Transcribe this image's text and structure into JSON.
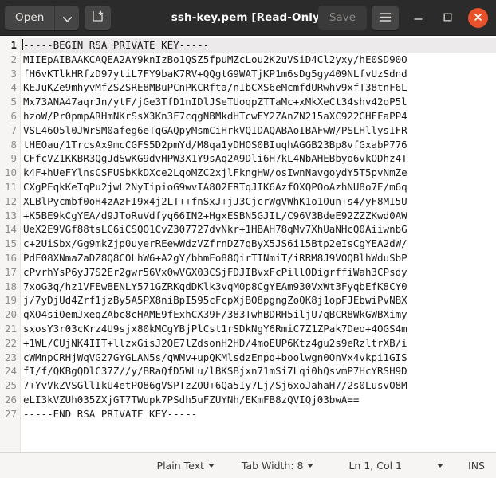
{
  "window": {
    "title": "ssh-key.pem [Read-Only]",
    "accent_close": "#e8512a",
    "headerbar_bg": "#2b2b2b",
    "button_bg": "#454545"
  },
  "headerbar": {
    "open_label": "Open",
    "open_dropdown_icon": "chevron-down-icon",
    "new_tab_icon": "new-tab-icon",
    "save_label": "Save",
    "menu_icon": "hamburger-menu-icon",
    "minimize_icon": "minimize-icon",
    "maximize_icon": "maximize-icon",
    "close_icon": "close-icon"
  },
  "editor": {
    "current_line": 1,
    "line_numbers": [
      1,
      2,
      3,
      4,
      5,
      6,
      7,
      8,
      9,
      10,
      11,
      12,
      13,
      14,
      15,
      16,
      17,
      18,
      19,
      20,
      21,
      22,
      23,
      24,
      25,
      26,
      27
    ],
    "lines": [
      "-----BEGIN RSA PRIVATE KEY-----",
      "MIIEpAIBAAKCAQEA2AY9knIzBo1QSZ5fpuMZcLou2K2uVSiD4Cl2yxy/hE0SD90O",
      "fH6vKTlkHRfzD97ytiL7FY9baK7RV+QQgtG9WATjKP1m6sDg5gy409NLfvUzSdnd",
      "KEJuKZe9mhyvMfZSZSRE8MBuPCnPKCRfta/nIbCXS6eMcmfdURwhv9xfT38tnF6L",
      "Mx73ANA47aqrJn/ytF/jGe3TfD1nIDlJSeTUoqpZTTaMc+xMkXeCt34shv42oP5l",
      "hzoW/Pr0pmpARHmNKrSsX3Kn3F7cqgNBMkdHTcwFY2ZAnZN215aXC922GHFFaPP4",
      "VSL46O5l0JWrSM0afeg6eTqGAQpyMsmCiHrkVQIDAQABAoIBAFwW/PSLHllysIFR",
      "tHEOau/1TrcsAx9mcCGFS5D2pmYd/M8qa1yDHOS0BIuqhAGGB23Bp8vfGxabP776",
      "CFfcVZ1KKBR3QgJdSwKG9dvHPW3X1Y9sAq2A9Dli6H7kL4NbAHEBbyo6vkODhz4T",
      "k4F+hUeFYlnsCSFUSbKkDXce2LqoMZC2xjlFkngHW/osIwnNavgoydY5T5pvNmZe",
      "CXgPEqkKeTqPu2jwL2NyTipioG9wvIA802FRTqJIK6AzfOXQPOoAzhNU8o7E/m6q",
      "XLBlPycmbf0oH4zAzFI9x4j2LT++fnSxJ+jJ3CjcrWgVWhK1o1Oun+s4/yF8MI5U",
      "+K5BE9kCgYEA/d9JToRuVdfyq66IN2+HgxESBN5GJIL/C96V3BdeE92ZZZKwd0AW",
      "UeX2E9VGf88tsLC6iCSQO1CvZ307727dvNkr+1HBAH78qMv7XhUaNHcQ0AiiwnbG",
      "c+2UiSbx/Gg9mkZjp0uyerREewWdzVZfrnDZ7qByX5JS6i15Btp2eIsCgYEA2dW/",
      "PdF08XNmaZaDZ8Q8COLhW6+A2gY/bhmEo88QirTINmiT/iRRM8J9VOQBlhWduSbP",
      "cPvrhYsP6yJ7S2Er2gwr56Vx0wVGX03CSjFDJIBvxFcPillODigrffiWah3CPsdy",
      "7xoG3q/hz1VFEwBENLY571GZRKqdDKlk3vqM0p8CgYEAm930VxWt3FyqbEfK8CY0",
      "j/7yDjUd4Zrf1jzBy5A5PX8niBpI595cFcpXjBO8pgngZoQK8j1opFJEbwiPvNBX",
      "qXO4siOemJxeqZAbc8cHAME9fExhCX39F/383TwhBDRH5iljU7qBCR8WkGWBXimy",
      "sxosY3r03cKrz4U9sjx80kMCgYBjPlCst1rSDkNgY6RmiC7Z1ZPak7Deo+4OGS4m",
      "+1WL/CUjNK4IIT+llzxGisJ2QE7lZdsonH2HD/4moEUP6Ktz4gu2s9eRzltrXB/i",
      "cWMnpCRHjWqVG27GYGLAN5s/qWMv+upQKMlsdzEnpq+boolwgn0OnVx4vkpi1GIS",
      "fI/f/QKBgQDlC37Z//y/BRaQfD5WLu/lBKSBjxn71mSi7Lqi0hQsvmP7HcYRSH9D",
      "7+YvVkZVSGllIkU4etPO86gVSPTzZOU+6Qa5Iy7Lj/Sj6xoJahaH7/2s0LusvO8M",
      "eLI3kVZUh035ZXjGT7TWupk7PSdh5uFZUYNh/EKmFB8zQVIQj03bwA==",
      "-----END RSA PRIVATE KEY-----"
    ]
  },
  "statusbar": {
    "language": "Plain Text",
    "tab_width": "Tab Width: 8",
    "position": "Ln 1, Col 1",
    "insert_mode": "INS"
  }
}
